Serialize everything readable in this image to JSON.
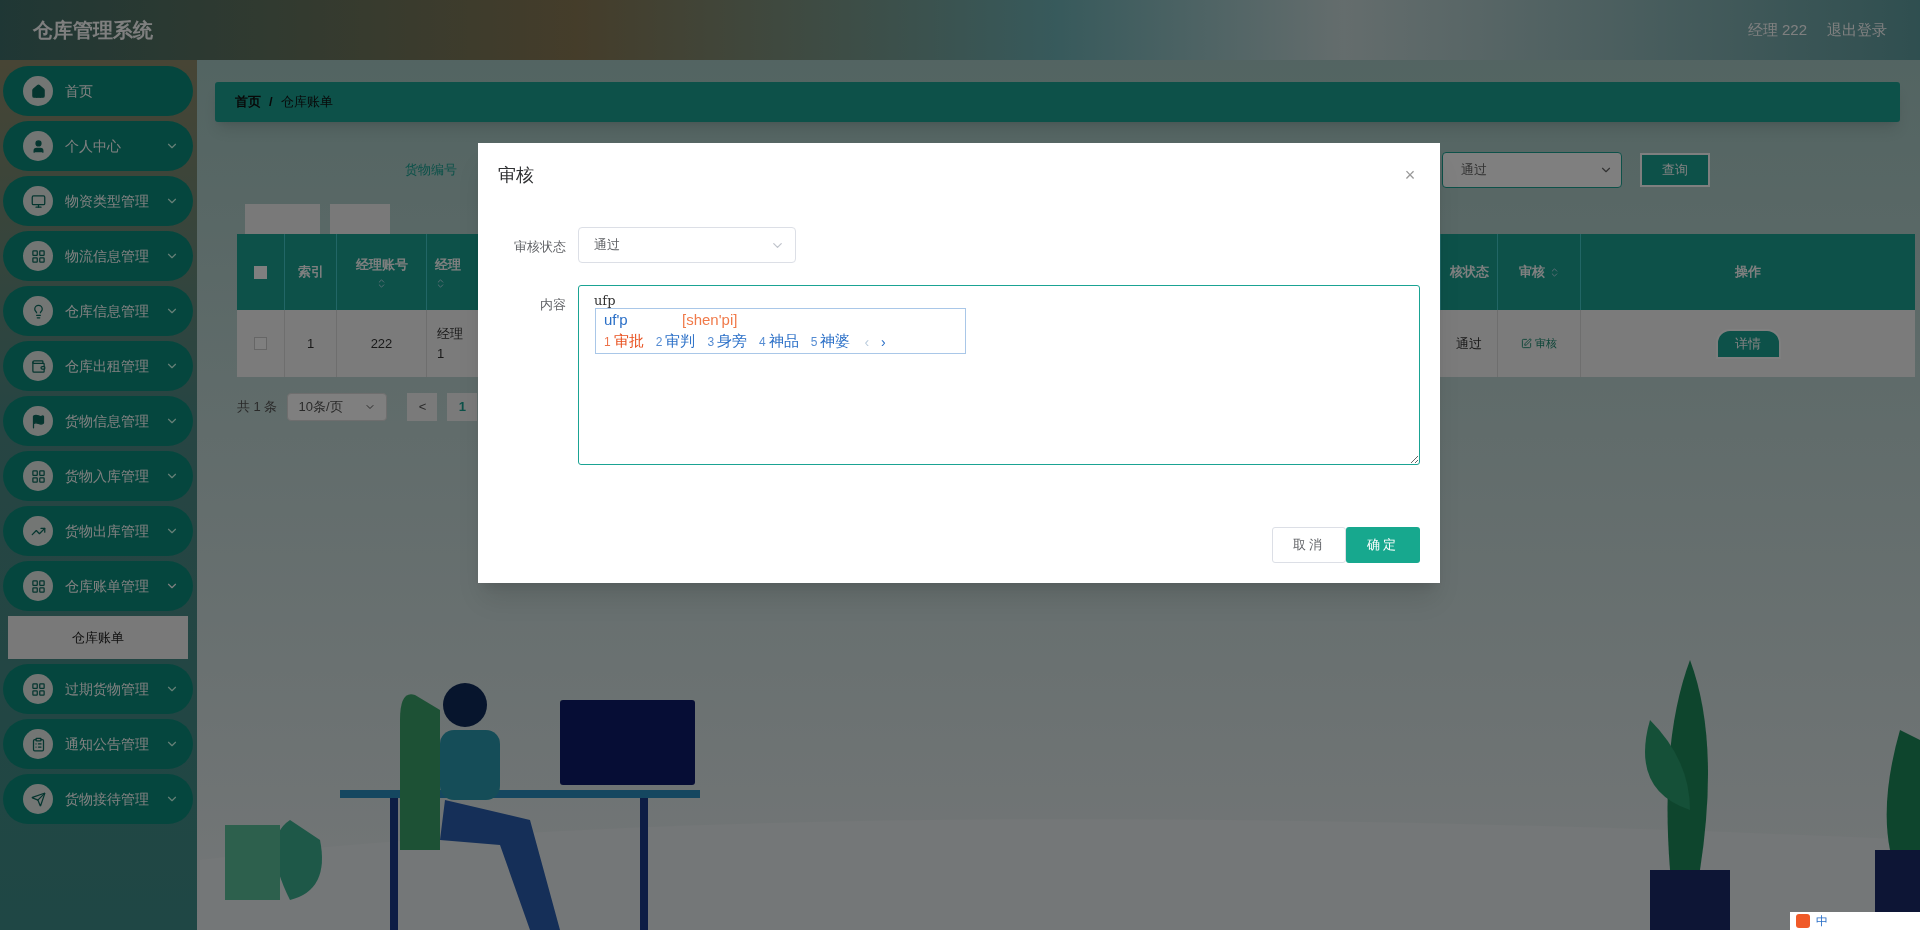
{
  "header": {
    "title": "仓库管理系统",
    "user": "经理 222",
    "logout": "退出登录"
  },
  "sidebar": {
    "items": [
      {
        "label": "首页"
      },
      {
        "label": "个人中心",
        "expanded": false
      },
      {
        "label": "物资类型管理",
        "expanded": false
      },
      {
        "label": "物流信息管理",
        "expanded": false
      },
      {
        "label": "仓库信息管理",
        "expanded": false
      },
      {
        "label": "仓库出租管理",
        "expanded": false
      },
      {
        "label": "货物信息管理",
        "expanded": false
      },
      {
        "label": "货物入库管理",
        "expanded": false
      },
      {
        "label": "货物出库管理",
        "expanded": false
      },
      {
        "label": "仓库账单管理",
        "expanded": true,
        "children": [
          {
            "label": "仓库账单",
            "selected": true
          }
        ]
      },
      {
        "label": "过期货物管理",
        "expanded": false
      },
      {
        "label": "通知公告管理",
        "expanded": false
      },
      {
        "label": "货物接待管理",
        "expanded": false
      }
    ]
  },
  "breadcrumb": {
    "items": [
      "首页",
      "仓库账单"
    ],
    "separator": "/"
  },
  "search": {
    "label": "货物编号",
    "status_value": "通过",
    "button": "查询"
  },
  "table": {
    "columns": [
      {
        "label": "索引",
        "sortable": false
      },
      {
        "label": "经理账号",
        "sortable": true
      },
      {
        "label": "经理",
        "sortable": true
      }
    ],
    "right_columns": [
      {
        "label": "核状态",
        "sortable": false
      },
      {
        "label": "审核",
        "sortable": true
      },
      {
        "label": "操作",
        "sortable": false
      }
    ],
    "header_checked": false,
    "rows": [
      {
        "checked": false,
        "cells": [
          "1",
          "222"
        ],
        "name_lines": [
          "经理",
          "1"
        ],
        "status": "通过",
        "review": "审核",
        "action": "详情"
      }
    ]
  },
  "pagination": {
    "total": "共 1 条",
    "page_size": "10条/页",
    "prev": "<",
    "page": "1"
  },
  "dialog": {
    "title": "审核",
    "close": "×",
    "fields": [
      {
        "kind": "select",
        "label": "审核状态",
        "value": "通过"
      },
      {
        "kind": "textarea",
        "label": "内容",
        "value": "ufp"
      }
    ],
    "buttons": [
      {
        "label": "取消",
        "primary": false
      },
      {
        "label": "确定",
        "primary": true
      }
    ]
  },
  "ime": {
    "composition": "uf'p",
    "pinyin": "[shen'pi]",
    "candidates": [
      {
        "index": "1",
        "text": "审批",
        "selected": true
      },
      {
        "index": "2",
        "text": "审判",
        "selected": false
      },
      {
        "index": "3",
        "text": "身旁",
        "selected": false
      },
      {
        "index": "4",
        "text": "神品",
        "selected": false
      },
      {
        "index": "5",
        "text": "神婆",
        "selected": false
      }
    ],
    "prev": "‹",
    "next": "›",
    "status": "中"
  }
}
